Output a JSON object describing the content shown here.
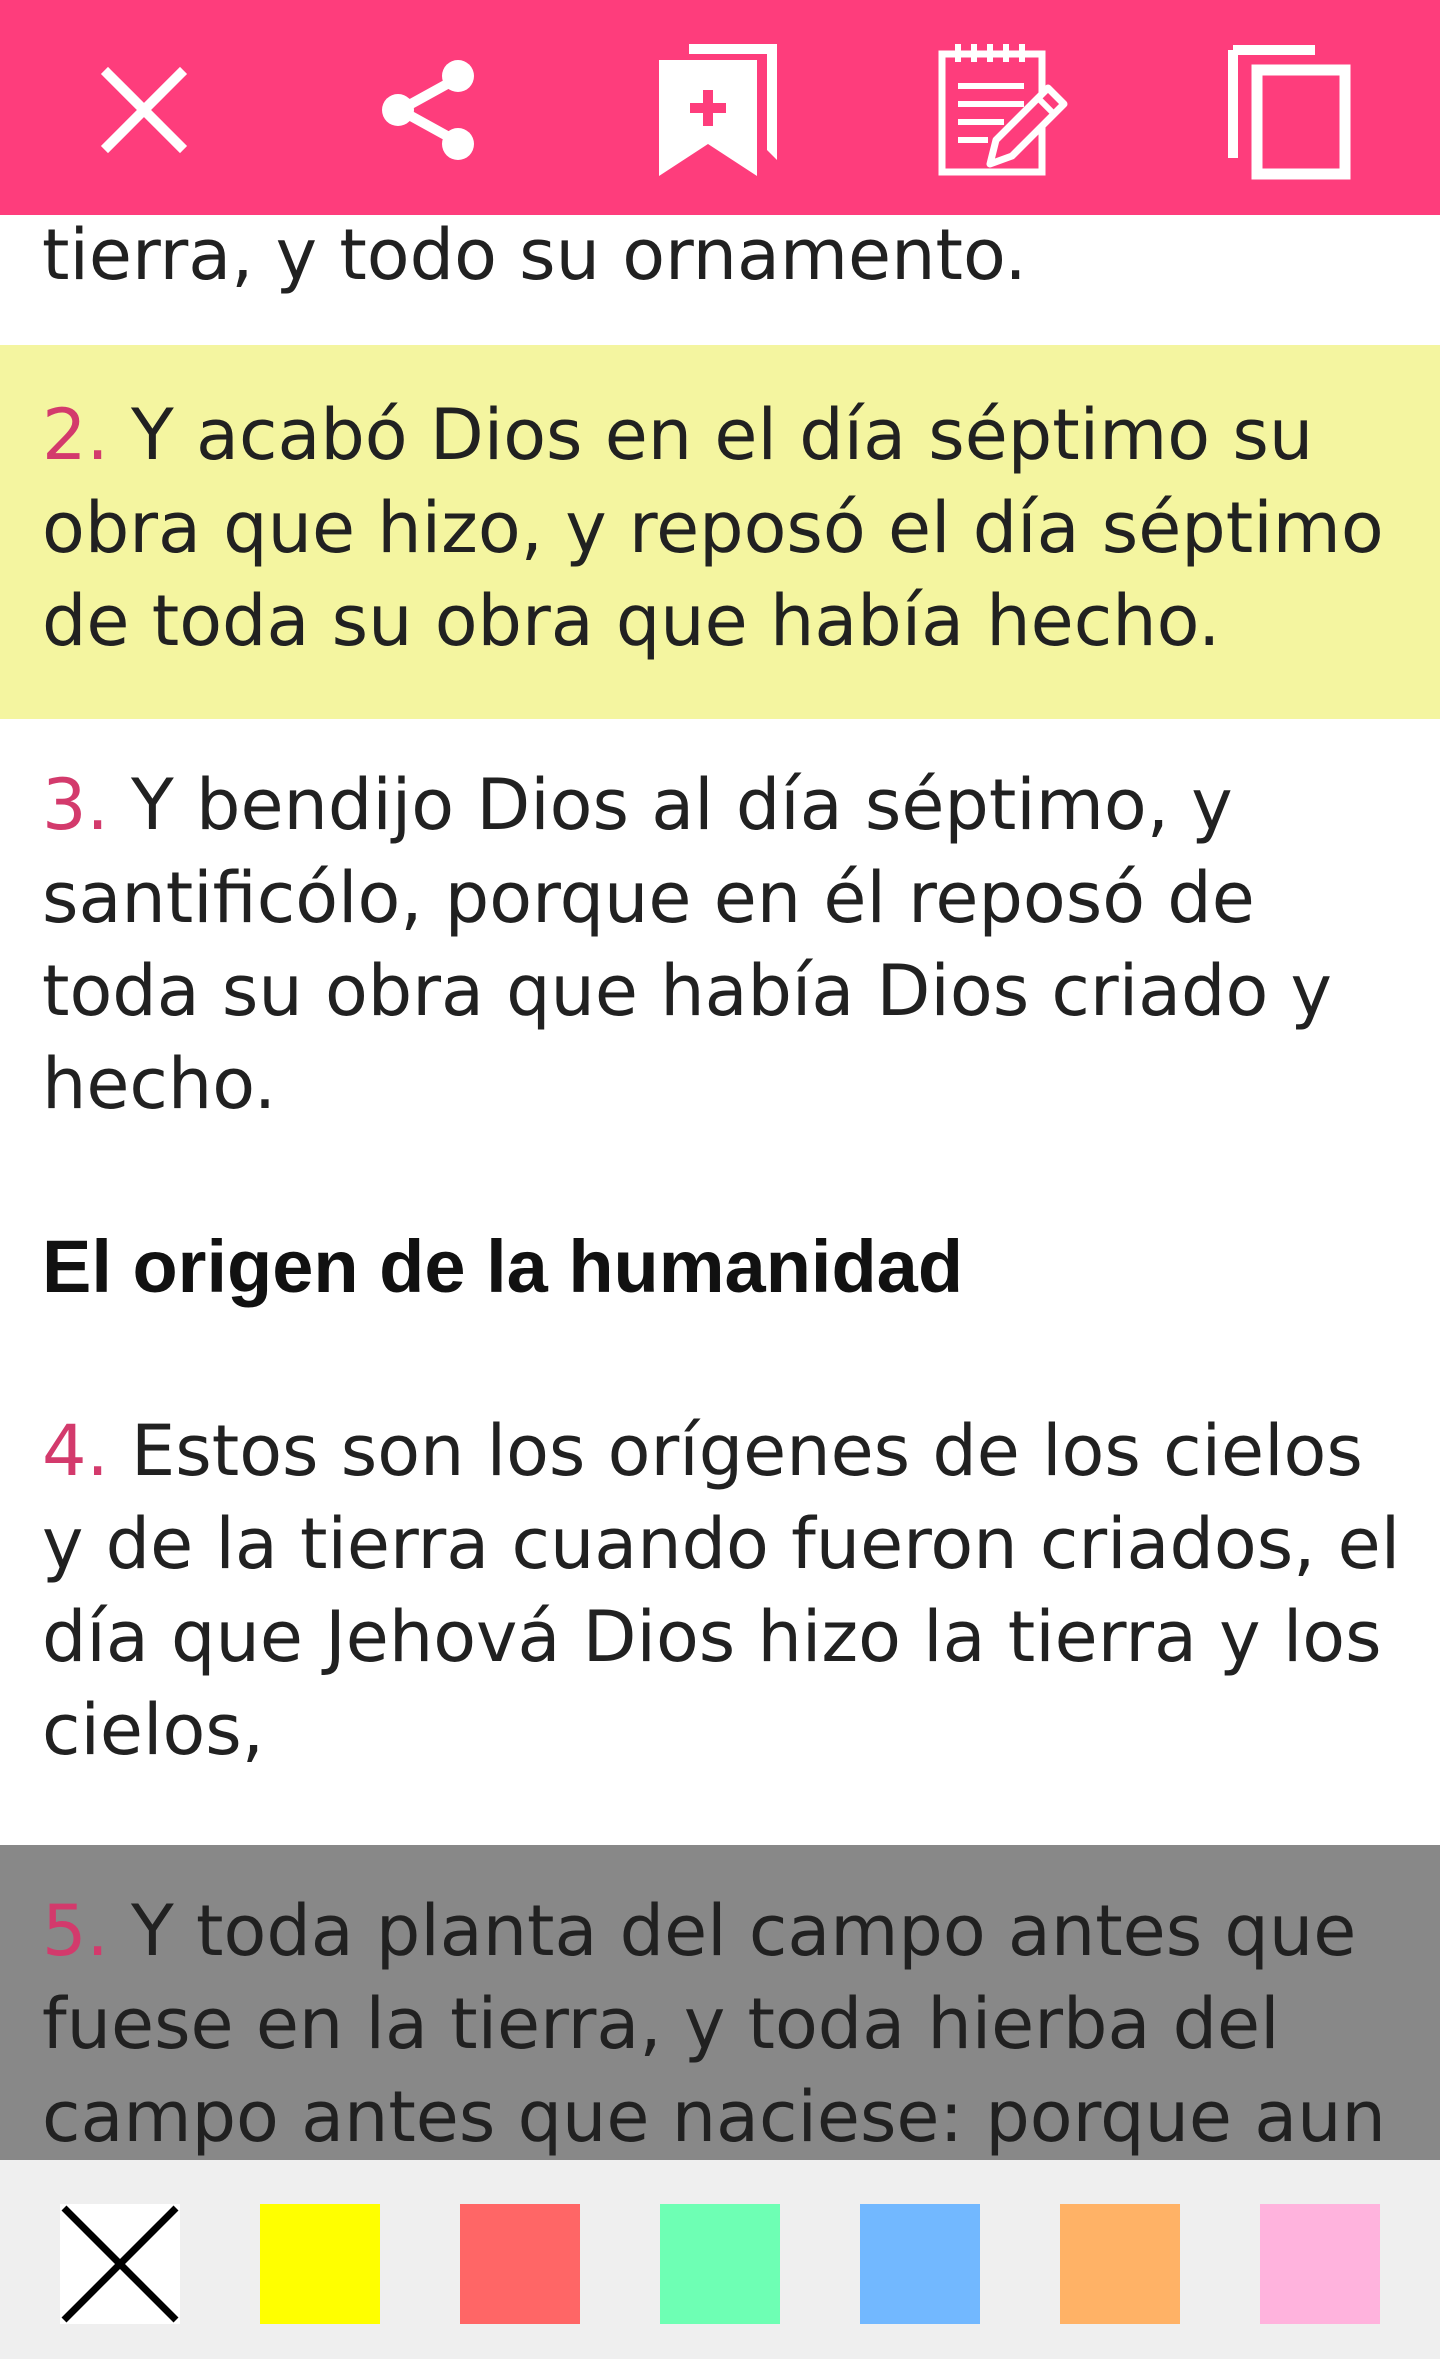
{
  "toolbar": {
    "background": "#fe3d7c",
    "actions": [
      {
        "name": "close-icon",
        "icon": "close"
      },
      {
        "name": "share-icon",
        "icon": "share"
      },
      {
        "name": "bookmark-add-icon",
        "icon": "bookmark-add"
      },
      {
        "name": "note-edit-icon",
        "icon": "note-edit"
      },
      {
        "name": "copy-icon",
        "icon": "copy"
      }
    ]
  },
  "verses": {
    "v1_tail": "tierra, y todo su ornamento.",
    "v2": {
      "num": "2.",
      "text": " Y acabó Dios en el día séptimo su obra que hizo, y reposó el día séptimo de toda su obra que había hecho.",
      "highlight": "#f4f5a0"
    },
    "v3": {
      "num": "3.",
      "text": " Y bendijo Dios al día séptimo, y santificólo, porque en él reposó de toda su obra que había Dios criado y hecho."
    },
    "heading": "El origen de la humanidad",
    "v4": {
      "num": "4.",
      "text": " Estos son los orígenes de los cielos y de la tierra cuando fueron criados, el día que Jehová Dios hizo la tierra y los cielos,"
    },
    "v5": {
      "num": "5.",
      "text": " Y toda planta del campo antes que fuese en la tierra, y toda hierba del campo antes que naciese: porque aun",
      "highlight": "#888888"
    }
  },
  "palette": {
    "background": "#efefef",
    "swatches": [
      {
        "name": "no-color",
        "color": "#ffffff"
      },
      {
        "name": "yellow",
        "color": "#ffff00"
      },
      {
        "name": "red",
        "color": "#ff6666"
      },
      {
        "name": "green",
        "color": "#6effb4"
      },
      {
        "name": "blue",
        "color": "#72b8ff"
      },
      {
        "name": "orange",
        "color": "#ffb266"
      },
      {
        "name": "pink",
        "color": "#ffb3dd"
      }
    ]
  }
}
